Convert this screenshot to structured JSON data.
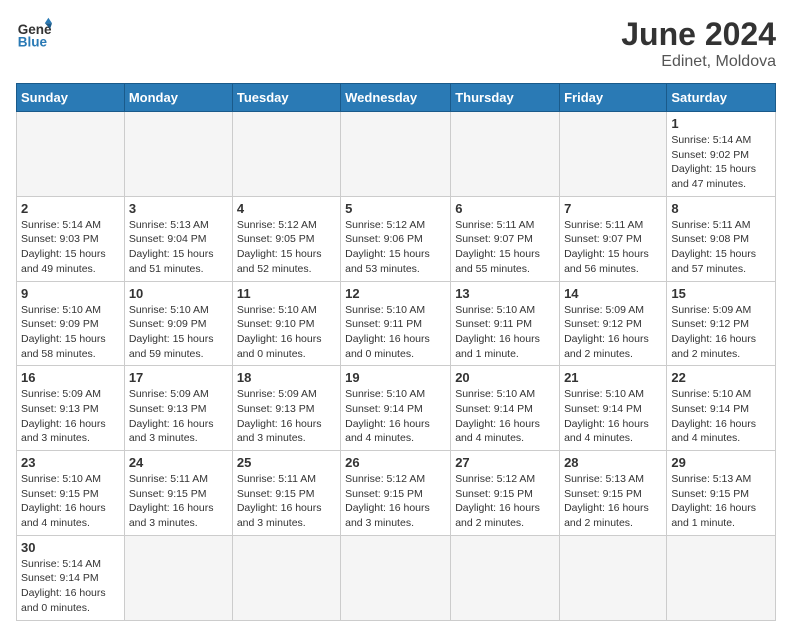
{
  "header": {
    "logo_general": "General",
    "logo_blue": "Blue",
    "month_title": "June 2024",
    "subtitle": "Edinet, Moldova"
  },
  "days_of_week": [
    "Sunday",
    "Monday",
    "Tuesday",
    "Wednesday",
    "Thursday",
    "Friday",
    "Saturday"
  ],
  "weeks": [
    [
      {
        "day": null,
        "info": null
      },
      {
        "day": null,
        "info": null
      },
      {
        "day": null,
        "info": null
      },
      {
        "day": null,
        "info": null
      },
      {
        "day": null,
        "info": null
      },
      {
        "day": null,
        "info": null
      },
      {
        "day": "1",
        "info": "Sunrise: 5:14 AM\nSunset: 9:02 PM\nDaylight: 15 hours and 47 minutes."
      }
    ],
    [
      {
        "day": "2",
        "info": "Sunrise: 5:14 AM\nSunset: 9:03 PM\nDaylight: 15 hours and 49 minutes."
      },
      {
        "day": "3",
        "info": "Sunrise: 5:13 AM\nSunset: 9:04 PM\nDaylight: 15 hours and 51 minutes."
      },
      {
        "day": "4",
        "info": "Sunrise: 5:12 AM\nSunset: 9:05 PM\nDaylight: 15 hours and 52 minutes."
      },
      {
        "day": "5",
        "info": "Sunrise: 5:12 AM\nSunset: 9:06 PM\nDaylight: 15 hours and 53 minutes."
      },
      {
        "day": "6",
        "info": "Sunrise: 5:11 AM\nSunset: 9:07 PM\nDaylight: 15 hours and 55 minutes."
      },
      {
        "day": "7",
        "info": "Sunrise: 5:11 AM\nSunset: 9:07 PM\nDaylight: 15 hours and 56 minutes."
      },
      {
        "day": "8",
        "info": "Sunrise: 5:11 AM\nSunset: 9:08 PM\nDaylight: 15 hours and 57 minutes."
      }
    ],
    [
      {
        "day": "9",
        "info": "Sunrise: 5:10 AM\nSunset: 9:09 PM\nDaylight: 15 hours and 58 minutes."
      },
      {
        "day": "10",
        "info": "Sunrise: 5:10 AM\nSunset: 9:09 PM\nDaylight: 15 hours and 59 minutes."
      },
      {
        "day": "11",
        "info": "Sunrise: 5:10 AM\nSunset: 9:10 PM\nDaylight: 16 hours and 0 minutes."
      },
      {
        "day": "12",
        "info": "Sunrise: 5:10 AM\nSunset: 9:11 PM\nDaylight: 16 hours and 0 minutes."
      },
      {
        "day": "13",
        "info": "Sunrise: 5:10 AM\nSunset: 9:11 PM\nDaylight: 16 hours and 1 minute."
      },
      {
        "day": "14",
        "info": "Sunrise: 5:09 AM\nSunset: 9:12 PM\nDaylight: 16 hours and 2 minutes."
      },
      {
        "day": "15",
        "info": "Sunrise: 5:09 AM\nSunset: 9:12 PM\nDaylight: 16 hours and 2 minutes."
      }
    ],
    [
      {
        "day": "16",
        "info": "Sunrise: 5:09 AM\nSunset: 9:13 PM\nDaylight: 16 hours and 3 minutes."
      },
      {
        "day": "17",
        "info": "Sunrise: 5:09 AM\nSunset: 9:13 PM\nDaylight: 16 hours and 3 minutes."
      },
      {
        "day": "18",
        "info": "Sunrise: 5:09 AM\nSunset: 9:13 PM\nDaylight: 16 hours and 3 minutes."
      },
      {
        "day": "19",
        "info": "Sunrise: 5:10 AM\nSunset: 9:14 PM\nDaylight: 16 hours and 4 minutes."
      },
      {
        "day": "20",
        "info": "Sunrise: 5:10 AM\nSunset: 9:14 PM\nDaylight: 16 hours and 4 minutes."
      },
      {
        "day": "21",
        "info": "Sunrise: 5:10 AM\nSunset: 9:14 PM\nDaylight: 16 hours and 4 minutes."
      },
      {
        "day": "22",
        "info": "Sunrise: 5:10 AM\nSunset: 9:14 PM\nDaylight: 16 hours and 4 minutes."
      }
    ],
    [
      {
        "day": "23",
        "info": "Sunrise: 5:10 AM\nSunset: 9:15 PM\nDaylight: 16 hours and 4 minutes."
      },
      {
        "day": "24",
        "info": "Sunrise: 5:11 AM\nSunset: 9:15 PM\nDaylight: 16 hours and 3 minutes."
      },
      {
        "day": "25",
        "info": "Sunrise: 5:11 AM\nSunset: 9:15 PM\nDaylight: 16 hours and 3 minutes."
      },
      {
        "day": "26",
        "info": "Sunrise: 5:12 AM\nSunset: 9:15 PM\nDaylight: 16 hours and 3 minutes."
      },
      {
        "day": "27",
        "info": "Sunrise: 5:12 AM\nSunset: 9:15 PM\nDaylight: 16 hours and 2 minutes."
      },
      {
        "day": "28",
        "info": "Sunrise: 5:13 AM\nSunset: 9:15 PM\nDaylight: 16 hours and 2 minutes."
      },
      {
        "day": "29",
        "info": "Sunrise: 5:13 AM\nSunset: 9:15 PM\nDaylight: 16 hours and 1 minute."
      }
    ],
    [
      {
        "day": "30",
        "info": "Sunrise: 5:14 AM\nSunset: 9:14 PM\nDaylight: 16 hours and 0 minutes."
      },
      {
        "day": null,
        "info": null
      },
      {
        "day": null,
        "info": null
      },
      {
        "day": null,
        "info": null
      },
      {
        "day": null,
        "info": null
      },
      {
        "day": null,
        "info": null
      },
      {
        "day": null,
        "info": null
      }
    ]
  ]
}
